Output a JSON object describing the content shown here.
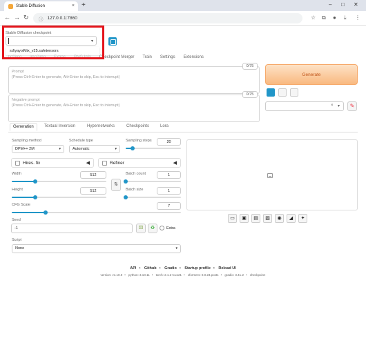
{
  "browser": {
    "tab_title": "Stable Diffusion",
    "url": "127.0.0.1:7860",
    "new_tab": "+",
    "tab_close": "×",
    "minimize": "–",
    "maximize": "□",
    "close": "✕"
  },
  "checkpoint": {
    "label": "Stable Diffusion checkpoint",
    "dropdown_option": "sd\\yayoiMix_v25.safetensors"
  },
  "top_tabs": [
    {
      "label": "txt2img"
    },
    {
      "label": "img2img"
    },
    {
      "label": "Extras"
    },
    {
      "label": "PNG Info"
    },
    {
      "label": "Checkpoint Merger"
    },
    {
      "label": "Train"
    },
    {
      "label": "Settings"
    },
    {
      "label": "Extensions"
    }
  ],
  "prompt": {
    "label": "Prompt",
    "hint": "(Press Ctrl+Enter to generate, Alt+Enter to skip, Esc to interrupt)",
    "counter": "0/75"
  },
  "negative_prompt": {
    "label": "Negative prompt",
    "hint": "(Press Ctrl+Enter to generate, Alt+Enter to skip, Esc to interrupt)",
    "counter": "0/75"
  },
  "generate_label": "Generate",
  "styles": {
    "clear": "×",
    "caret": "▾",
    "paint": "✎"
  },
  "sub_tabs": [
    {
      "label": "Generation"
    },
    {
      "label": "Textual Inversion"
    },
    {
      "label": "Hypernetworks"
    },
    {
      "label": "Checkpoints"
    },
    {
      "label": "Lora"
    }
  ],
  "generation": {
    "sampling_method_label": "Sampling method",
    "sampling_method_value": "DPM++ 2M",
    "schedule_type_label": "Schedule type",
    "schedule_type_value": "Automatic",
    "sampling_steps_label": "Sampling steps",
    "sampling_steps_value": "20",
    "sampling_steps_fraction": 0.13,
    "hires_label": "Hires. fix",
    "refiner_label": "Refiner",
    "width_label": "Width",
    "width_value": "512",
    "width_fraction": 0.25,
    "height_label": "Height",
    "height_value": "512",
    "height_fraction": 0.25,
    "batch_count_label": "Batch count",
    "batch_count_value": "1",
    "batch_count_fraction": 0.0,
    "batch_size_label": "Batch size",
    "batch_size_value": "1",
    "batch_size_fraction": 0.0,
    "cfg_label": "CFG Scale",
    "cfg_value": "7",
    "cfg_fraction": 0.2,
    "seed_label": "Seed",
    "seed_value": "-1",
    "extra_label": "Extra",
    "script_label": "Script",
    "script_value": "None"
  },
  "footer": {
    "links": [
      "API",
      "Github",
      "Gradio",
      "Startup profile",
      "Reload UI"
    ],
    "versions": [
      "version: v1.10.0",
      "python: 3.10.11",
      "torch: 2.1.2+cu121",
      "xformers: 0.0.23.post1",
      "gradio: 3.41.2",
      "checkpoint:"
    ]
  },
  "colors": {
    "accent": "#2196c8",
    "generate_bg": "#f9b980",
    "highlight": "#e4141b"
  }
}
